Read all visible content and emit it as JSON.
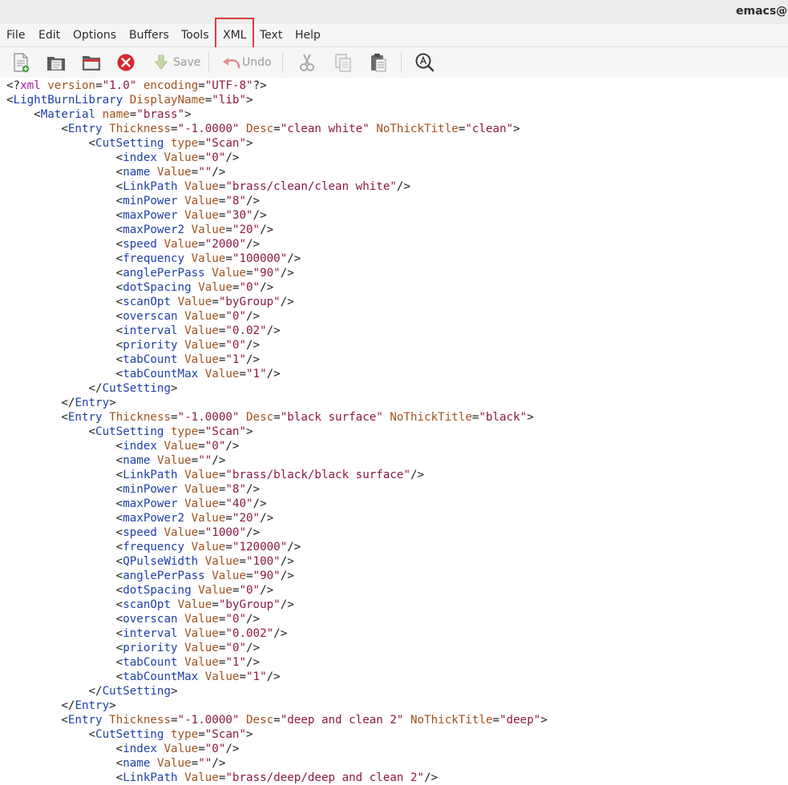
{
  "window": {
    "title": "emacs@C"
  },
  "menubar": {
    "items": [
      "File",
      "Edit",
      "Options",
      "Buffers",
      "Tools",
      "XML",
      "Text",
      "Help"
    ],
    "highlighted": "XML"
  },
  "toolbar": {
    "save_label": "Save",
    "undo_label": "Undo",
    "icons": [
      "new-file-icon",
      "open-folder-icon",
      "open-directory-icon",
      "close-buffer-icon",
      "save-icon",
      "undo-icon",
      "cut-icon",
      "copy-icon",
      "paste-icon",
      "search-icon"
    ]
  },
  "colors": {
    "tag_name": "#1e40a8",
    "attr_name": "#a0521d",
    "attr_value": "#8b1a3c",
    "processing_instruction": "#a020a0",
    "highlight_box": "#e03c3c",
    "close_icon": "#d9262c"
  },
  "editor": {
    "lines": [
      "<?xml version=\"1.0\" encoding=\"UTF-8\"?>",
      "<LightBurnLibrary DisplayName=\"lib\">",
      "    <Material name=\"brass\">",
      "        <Entry Thickness=\"-1.0000\" Desc=\"clean white\" NoThickTitle=\"clean\">",
      "            <CutSetting type=\"Scan\">",
      "                <index Value=\"0\"/>",
      "                <name Value=\"\"/>",
      "                <LinkPath Value=\"brass/clean/clean white\"/>",
      "                <minPower Value=\"8\"/>",
      "                <maxPower Value=\"30\"/>",
      "                <maxPower2 Value=\"20\"/>",
      "                <speed Value=\"2000\"/>",
      "                <frequency Value=\"100000\"/>",
      "                <anglePerPass Value=\"90\"/>",
      "                <dotSpacing Value=\"0\"/>",
      "                <scanOpt Value=\"byGroup\"/>",
      "                <overscan Value=\"0\"/>",
      "                <interval Value=\"0.02\"/>",
      "                <priority Value=\"0\"/>",
      "                <tabCount Value=\"1\"/>",
      "                <tabCountMax Value=\"1\"/>",
      "            </CutSetting>",
      "        </Entry>",
      "        <Entry Thickness=\"-1.0000\" Desc=\"black surface\" NoThickTitle=\"black\">",
      "            <CutSetting type=\"Scan\">",
      "                <index Value=\"0\"/>",
      "                <name Value=\"\"/>",
      "                <LinkPath Value=\"brass/black/black surface\"/>",
      "                <minPower Value=\"8\"/>",
      "                <maxPower Value=\"40\"/>",
      "                <maxPower2 Value=\"20\"/>",
      "                <speed Value=\"1000\"/>",
      "                <frequency Value=\"120000\"/>",
      "                <QPulseWidth Value=\"100\"/>",
      "                <anglePerPass Value=\"90\"/>",
      "                <dotSpacing Value=\"0\"/>",
      "                <scanOpt Value=\"byGroup\"/>",
      "                <overscan Value=\"0\"/>",
      "                <interval Value=\"0.002\"/>",
      "                <priority Value=\"0\"/>",
      "                <tabCount Value=\"1\"/>",
      "                <tabCountMax Value=\"1\"/>",
      "            </CutSetting>",
      "        </Entry>",
      "        <Entry Thickness=\"-1.0000\" Desc=\"deep and clean 2\" NoThickTitle=\"deep\">",
      "            <CutSetting type=\"Scan\">",
      "                <index Value=\"0\"/>",
      "                <name Value=\"\"/>",
      "                <LinkPath Value=\"brass/deep/deep and clean 2\"/>"
    ]
  }
}
